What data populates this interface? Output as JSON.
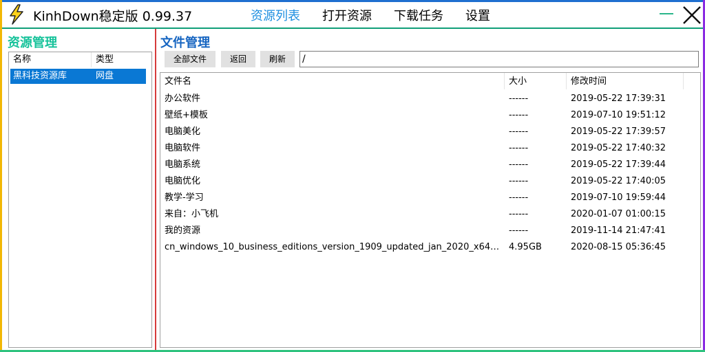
{
  "app": {
    "title": "KinhDown稳定版 0.99.37"
  },
  "nav": [
    {
      "label": "资源列表",
      "active": true
    },
    {
      "label": "打开资源",
      "active": false
    },
    {
      "label": "下载任务",
      "active": false
    },
    {
      "label": "设置",
      "active": false
    }
  ],
  "colors": {
    "accent": "#1e8fe0",
    "left_title": "#16c29a",
    "right_title": "#1665c1",
    "selection": "#0a78d4"
  },
  "left": {
    "title": "资源管理",
    "columns": [
      "名称",
      "类型"
    ],
    "rows": [
      {
        "name": "黑科技资源库",
        "type": "网盘"
      }
    ]
  },
  "right": {
    "title": "文件管理",
    "buttons": [
      "全部文件",
      "返回",
      "刷新"
    ],
    "path": "/",
    "columns": [
      "文件名",
      "大小",
      "修改时间"
    ],
    "files": [
      {
        "name": "办公软件",
        "size": "------",
        "time": "2019-05-22 17:39:31"
      },
      {
        "name": "壁纸+模板",
        "size": "------",
        "time": "2019-07-10 19:51:12"
      },
      {
        "name": "电脑美化",
        "size": "------",
        "time": "2019-05-22 17:39:57"
      },
      {
        "name": "电脑软件",
        "size": "------",
        "time": "2019-05-22 17:40:32"
      },
      {
        "name": "电脑系统",
        "size": "------",
        "time": "2019-05-22 17:39:44"
      },
      {
        "name": "电脑优化",
        "size": "------",
        "time": "2019-05-22 17:40:05"
      },
      {
        "name": "教学-学习",
        "size": "------",
        "time": "2019-07-10 19:59:44"
      },
      {
        "name": "来自：小飞机",
        "size": "------",
        "time": "2020-01-07 01:00:15"
      },
      {
        "name": "我的资源",
        "size": "------",
        "time": "2019-11-14 21:47:41"
      },
      {
        "name": "cn_windows_10_business_editions_version_1909_updated_jan_2020_x64_…",
        "size": "4.95GB",
        "time": "2020-08-15 05:36:45"
      }
    ]
  }
}
